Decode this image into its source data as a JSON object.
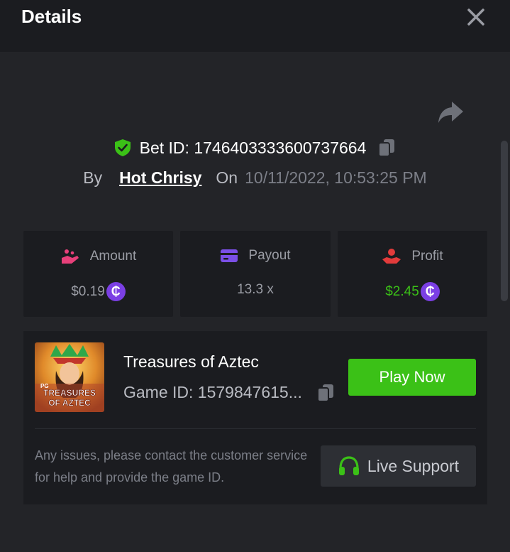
{
  "header": {
    "title": "Details",
    "close_icon": "close-icon"
  },
  "bet": {
    "id_text": "Bet ID: 1746403333600737664",
    "by_label": "By",
    "user": "Hot Chrisy",
    "on_label": "On",
    "date": "10/11/2022, 10:53:25 PM"
  },
  "stats": [
    {
      "label": "Amount",
      "value": "$0.19",
      "icon": "coin-hand-icon",
      "color": "#9a9ca4"
    },
    {
      "label": "Payout",
      "value": "13.3 x",
      "icon": "wallet-card-icon",
      "color": "#9a9ca4"
    },
    {
      "label": "Profit",
      "value": "$2.45",
      "icon": "profit-hand-icon",
      "color": "#3bc117"
    }
  ],
  "currency_symbol": "₵",
  "game": {
    "name": "Treasures of Aztec",
    "id_text": "Game ID: 1579847615...",
    "thumb_brand": "PG",
    "thumb_line1": "TREASURES",
    "thumb_line2": "OF AZTEC",
    "play_label": "Play Now"
  },
  "support": {
    "notice": "Any issues, please contact the customer service for help and provide the game ID.",
    "button_label": "Live Support"
  },
  "colors": {
    "accent_green": "#3bc117",
    "coin_purple": "#7b3fe4",
    "amount_pink": "#e8407a",
    "payout_purple": "#7b4fe6",
    "profit_red": "#e23b3b"
  }
}
